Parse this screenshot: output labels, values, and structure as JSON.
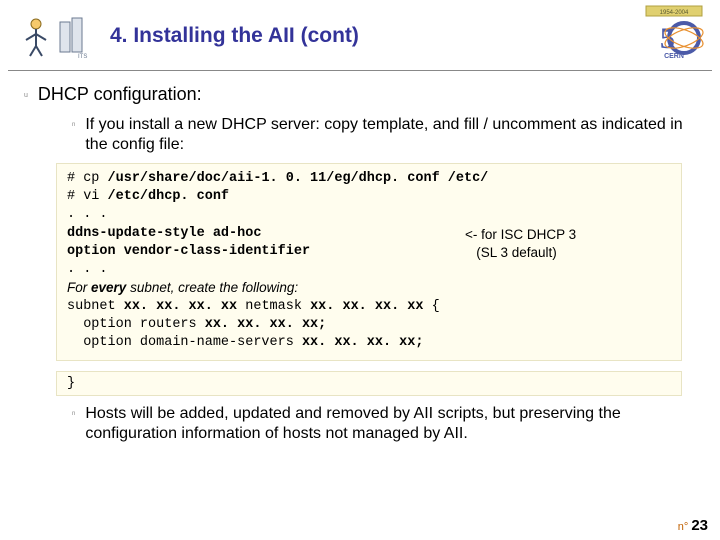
{
  "header": {
    "title": "4. Installing the AII (cont)"
  },
  "content": {
    "h1": "DHCP configuration:",
    "p1": "If you install a new DHCP server: copy template, and fill / uncomment as indicated in the config file:",
    "p2": "Hosts will be added, updated and removed by AII scripts, but preserving the configuration information of hosts not managed by AII."
  },
  "code": {
    "l1a": "# cp ",
    "l1b": "/usr/share/doc/aii-1. 0. 11/eg/dhcp. conf /etc/",
    "l2a": "# vi ",
    "l2b": "/etc/dhcp. conf",
    "l3": ". . .",
    "l4": "ddns-update-style ad-hoc",
    "l5": "option vendor-class-identifier",
    "l6": ". . .",
    "l7a": "For ",
    "l7b": "every",
    "l7c": " subnet, create the following:",
    "l8a": "subnet ",
    "l8b": "xx. xx. xx. xx",
    "l8c": " netmask ",
    "l8d": "xx. xx. xx. xx",
    "l8e": " {",
    "l9a": "  option routers ",
    "l9b": "xx. xx. xx. xx;",
    "l10a": "  option domain-name-servers ",
    "l10b": "xx. xx. xx. xx;",
    "close": "}",
    "annot1": "<- for ISC DHCP 3",
    "annot2": "   (SL 3 default)"
  },
  "footer": {
    "prefix": "n°",
    "page": "23"
  }
}
